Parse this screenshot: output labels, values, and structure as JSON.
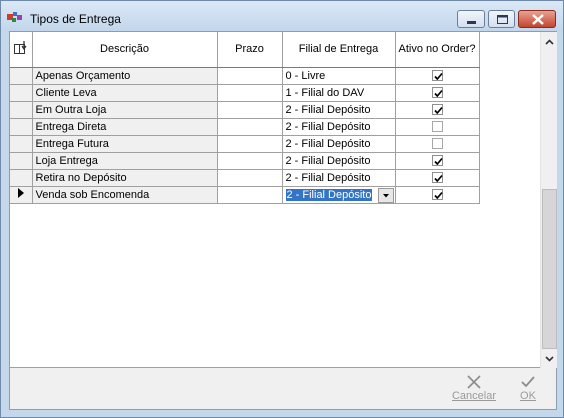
{
  "window": {
    "title": "Tipos de Entrega"
  },
  "grid": {
    "columns": [
      "Descrição",
      "Prazo",
      "Filial de Entrega",
      "Ativo no Order?"
    ],
    "rows": [
      {
        "descricao": "Apenas Orçamento",
        "prazo": "",
        "filial": "0 - Livre",
        "ativo": true
      },
      {
        "descricao": "Cliente Leva",
        "prazo": "",
        "filial": "1 - Filial do DAV",
        "ativo": true
      },
      {
        "descricao": "Em Outra Loja",
        "prazo": "",
        "filial": "2 - Filial Depósito",
        "ativo": true
      },
      {
        "descricao": "Entrega Direta",
        "prazo": "",
        "filial": "2 - Filial Depósito",
        "ativo": false
      },
      {
        "descricao": "Entrega Futura",
        "prazo": "",
        "filial": "2 - Filial Depósito",
        "ativo": false
      },
      {
        "descricao": "Loja Entrega",
        "prazo": "",
        "filial": "2 - Filial Depósito",
        "ativo": true
      },
      {
        "descricao": "Retira no Depósito",
        "prazo": "",
        "filial": "2 - Filial Depósito",
        "ativo": true
      },
      {
        "descricao": "Venda sob Encomenda",
        "prazo": "",
        "filial": "2 - Filial Depósito",
        "ativo": true
      }
    ],
    "current_row": 7
  },
  "footer": {
    "cancel_label": "Cancelar",
    "ok_label": "OK"
  },
  "icons": {
    "app": "app-icon",
    "header_corner": "sort-column-icon",
    "row_pointer": "current-row-pointer-icon",
    "cancel": "x-icon",
    "ok": "checkmark-icon"
  },
  "colors": {
    "selection": "#3374c7",
    "title_bar": "#c5d7ea"
  }
}
